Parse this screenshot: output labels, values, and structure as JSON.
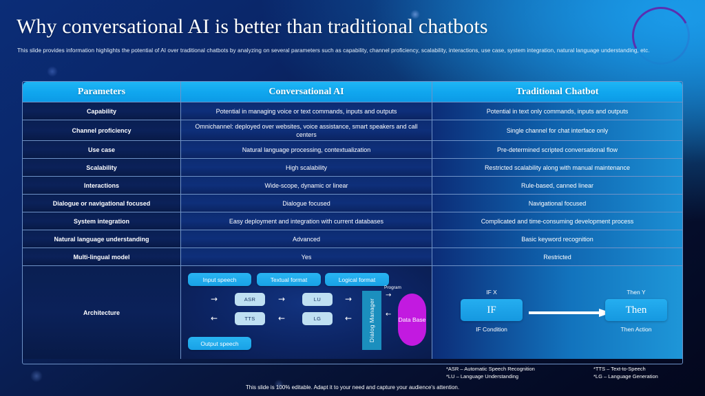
{
  "slide": {
    "title": "Why conversational AI is better than traditional chatbots",
    "subtitle": "This slide provides information highlights the potential of AI  over traditional chatbots by analyzing on several parameters such as capability, channel proficiency, scalability, interactions, use case, system integration, natural language understanding, etc.",
    "footer_note": "This slide is 100% editable.  Adapt it to your need and capture your audience's attention."
  },
  "colors": {
    "header_blue": "#10a6ee",
    "param_navy": "#0b2159",
    "ai_blue": "#0e2f7a",
    "chatbot_gradient_end": "#1b8fd4",
    "pill_blue": "#18a2e6",
    "smallbox_light": "#bfe0f2",
    "dialog_manager_teal": "#1b8fbe",
    "database_magenta": "#c21ae0",
    "ring_purple": "#5b2fb0"
  },
  "table": {
    "headers": [
      "Parameters",
      "Conversational AI",
      "Traditional Chatbot"
    ],
    "rows": [
      {
        "parameter": "Capability",
        "ai": "Potential in managing voice  or text commands, inputs and outputs",
        "chatbot": "Potential in text only commands, inputs and outputs"
      },
      {
        "parameter": "Channel proficiency",
        "ai": "Omnichannel: deployed over websites, voice  assistance, smart speakers and call centers",
        "chatbot": "Single channel for  chat interface  only"
      },
      {
        "parameter": "Use  case",
        "ai": "Natural language processing,  contextualization",
        "chatbot": "Pre-determined  scripted conversational  flow"
      },
      {
        "parameter": "Scalability",
        "ai": "High  scalability",
        "chatbot": "Restricted scalability along with manual  maintenance"
      },
      {
        "parameter": "Interactions",
        "ai": "Wide-scope, dynamic  or linear",
        "chatbot": "Rule-based,  canned linear"
      },
      {
        "parameter": "Dialogue or navigational focused",
        "ai": "Dialogue  focused",
        "chatbot": "Navigational  focused"
      },
      {
        "parameter": "System  integration",
        "ai": "Easy deployment and integration with current databases",
        "chatbot": "Complicated and time-consuming  development  process"
      },
      {
        "parameter": "Natural language understanding",
        "ai": "Advanced",
        "chatbot": "Basic keyword recognition"
      },
      {
        "parameter": "Multi-lingual model",
        "ai": "Yes",
        "chatbot": "Restricted"
      }
    ],
    "architecture_row_label": "Architecture"
  },
  "architecture_ai": {
    "pills": [
      {
        "label": "Input  speech"
      },
      {
        "label": "Textual format"
      },
      {
        "label": "Logical format"
      },
      {
        "label": "Output  speech"
      }
    ],
    "boxes": [
      {
        "label": "ASR"
      },
      {
        "label": "TTS"
      },
      {
        "label": "LU"
      },
      {
        "label": "LG"
      }
    ],
    "dialog_manager": "Dialog Manager",
    "database": "Data Base",
    "program_label": "Program",
    "arrows": {
      "right": "→",
      "left": "←"
    }
  },
  "architecture_chatbot": {
    "if_top_label": "IF X",
    "if_box": "IF",
    "if_bottom_label": "IF Condition",
    "then_top_label": "Then  Y",
    "then_box": "Then",
    "then_bottom_label": "Then  Action"
  },
  "footnotes": {
    "left_line1": "*ASR – Automatic Speech Recognition",
    "left_line2": "*LU – Language Understanding",
    "right_line1": "*TTS – Text-to-Speech",
    "right_line2": "*LG – Language Generation"
  }
}
